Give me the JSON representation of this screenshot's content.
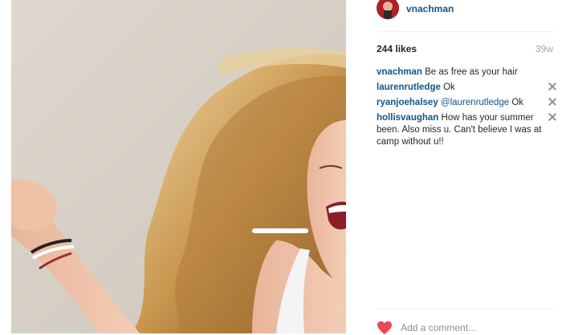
{
  "post": {
    "username": "vnachman",
    "likes": "244 likes",
    "age": "39w"
  },
  "comments": [
    {
      "user": "vnachman",
      "mention": "",
      "text": "Be as free as your hair",
      "deletable": false
    },
    {
      "user": "laurenrutledge",
      "mention": "",
      "text": "Ok",
      "deletable": true
    },
    {
      "user": "ryanjoehalsey",
      "mention": "@laurenrutledge",
      "text": "Ok",
      "deletable": true
    },
    {
      "user": "hollisvaughan",
      "mention": "",
      "text": "How has your summer been. Also miss u. Can't believe I was at camp without u!!",
      "deletable": true
    }
  ],
  "composer": {
    "placeholder": "Add a comment..."
  },
  "icons": {
    "like": "heart-icon",
    "delete": "close-icon"
  },
  "colors": {
    "username": "#125688",
    "heart": "#ed4956",
    "meta": "#a5a7aa"
  }
}
